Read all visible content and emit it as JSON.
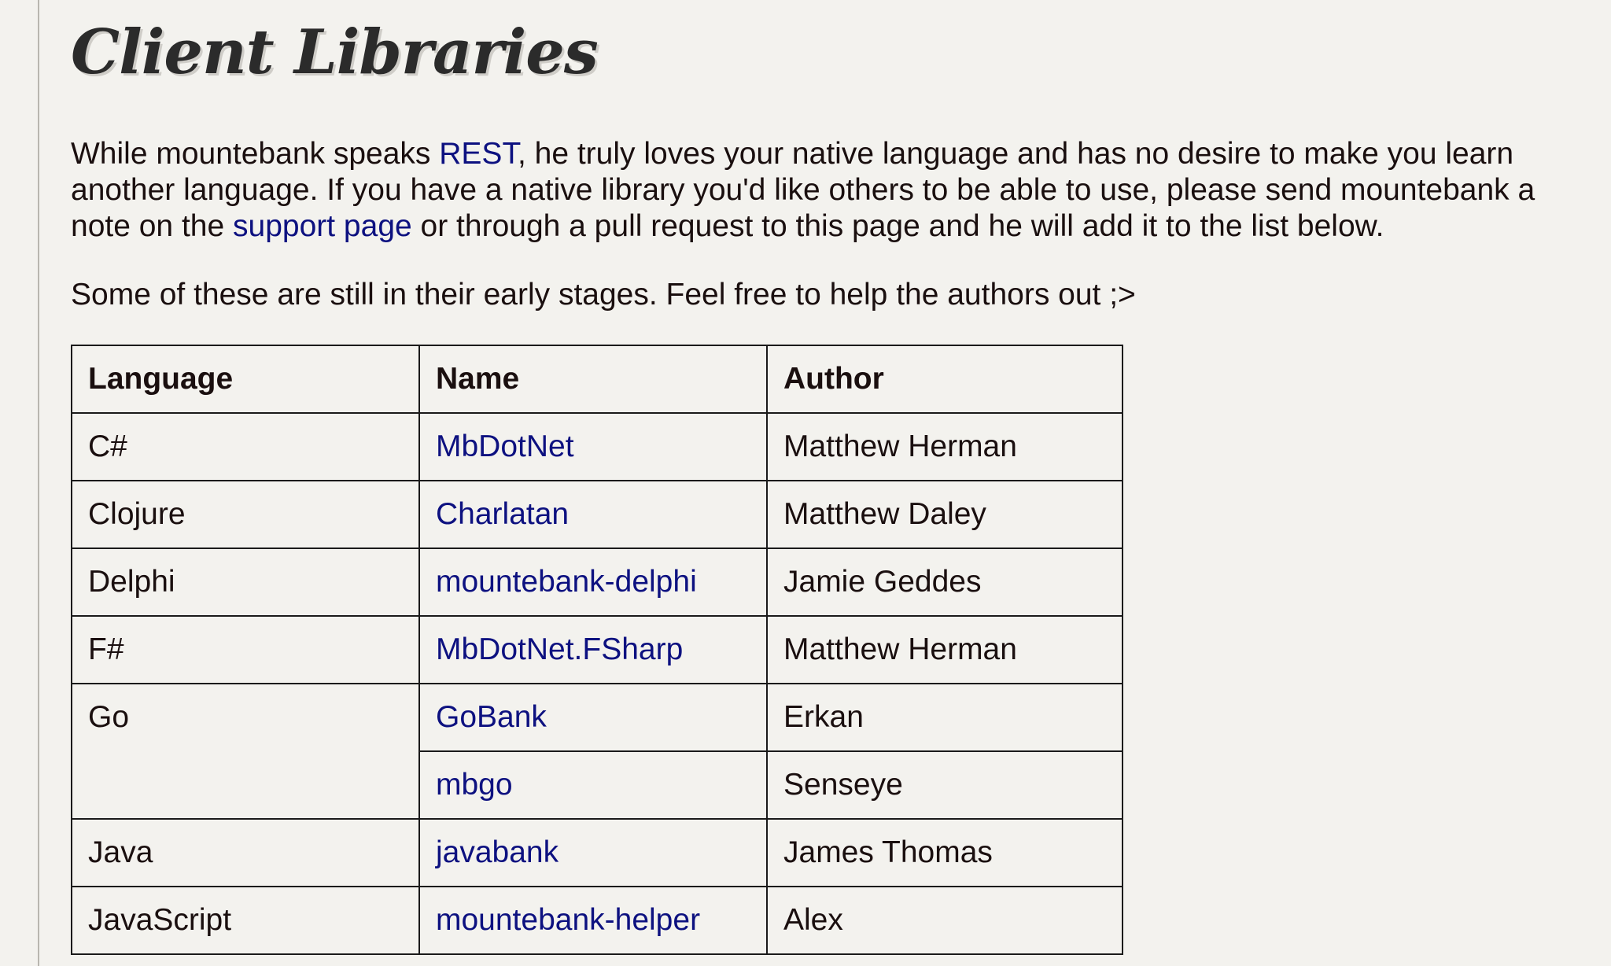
{
  "page": {
    "title": "Client Libraries",
    "intro": {
      "before_rest": "While mountebank speaks ",
      "rest_link": "REST",
      "after_rest": ", he truly loves your native language and has no desire to make you learn another language. If you have a native library you'd like others to be able to use, please send mountebank a note on the ",
      "support_link": "support page",
      "after_support": " or through a pull request to this page and he will add it to the list below."
    },
    "note": "Some of these are still in their early stages. Feel free to help the authors out ;>"
  },
  "table": {
    "headers": [
      "Language",
      "Name",
      "Author"
    ],
    "rows": [
      {
        "language": "C#",
        "name": "MbDotNet",
        "author": "Matthew Herman"
      },
      {
        "language": "Clojure",
        "name": "Charlatan",
        "author": "Matthew Daley"
      },
      {
        "language": "Delphi",
        "name": "mountebank-delphi",
        "author": "Jamie Geddes"
      },
      {
        "language": "F#",
        "name": "MbDotNet.FSharp",
        "author": "Matthew Herman"
      },
      {
        "language": "Go",
        "name": "GoBank",
        "author": "Erkan"
      },
      {
        "language": "",
        "name": "mbgo",
        "author": "Senseye"
      },
      {
        "language": "Java",
        "name": "javabank",
        "author": "James Thomas"
      },
      {
        "language": "JavaScript",
        "name": "mountebank-helper",
        "author": "Alex"
      }
    ]
  },
  "colors": {
    "background": "#f3f2ee",
    "text": "#1a0f0f",
    "link": "#0d1180",
    "heading": "#2b2b2b"
  }
}
